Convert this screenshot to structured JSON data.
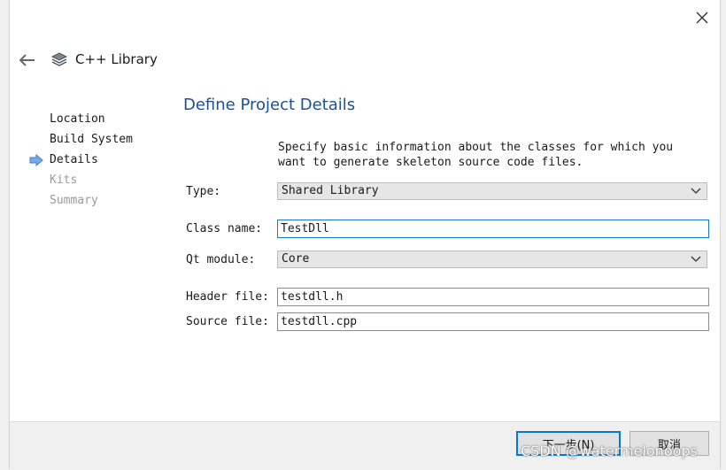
{
  "window": {
    "title": "C++ Library",
    "icons": {
      "close": "close-icon",
      "back": "back-arrow-icon",
      "wizard": "library-stack-icon"
    }
  },
  "steps": [
    {
      "label": "Location",
      "state": "done"
    },
    {
      "label": "Build System",
      "state": "done"
    },
    {
      "label": "Details",
      "state": "current"
    },
    {
      "label": "Kits",
      "state": "pending"
    },
    {
      "label": "Summary",
      "state": "pending"
    }
  ],
  "page": {
    "title": "Define Project Details",
    "description_line1": "Specify basic information about the classes for which you",
    "description_line2": "want to generate skeleton source code files."
  },
  "form": {
    "type": {
      "label": "Type:",
      "value": "Shared Library"
    },
    "class_name": {
      "label": "Class name:",
      "value": "TestDll"
    },
    "qt_module": {
      "label": "Qt module:",
      "value": "Core"
    },
    "header_file": {
      "label": "Header file:",
      "value": "testdll.h"
    },
    "source_file": {
      "label": "Source file:",
      "value": "testdll.cpp"
    }
  },
  "buttons": {
    "next": "下一步(N)",
    "cancel": "取消"
  },
  "watermark": "CSDN @watermelonoops",
  "colors": {
    "title_blue": "#1e4f95",
    "step_arrow": "#3f7fd2",
    "focus_border": "#1979d2",
    "default_button_border": "#0078d7"
  }
}
